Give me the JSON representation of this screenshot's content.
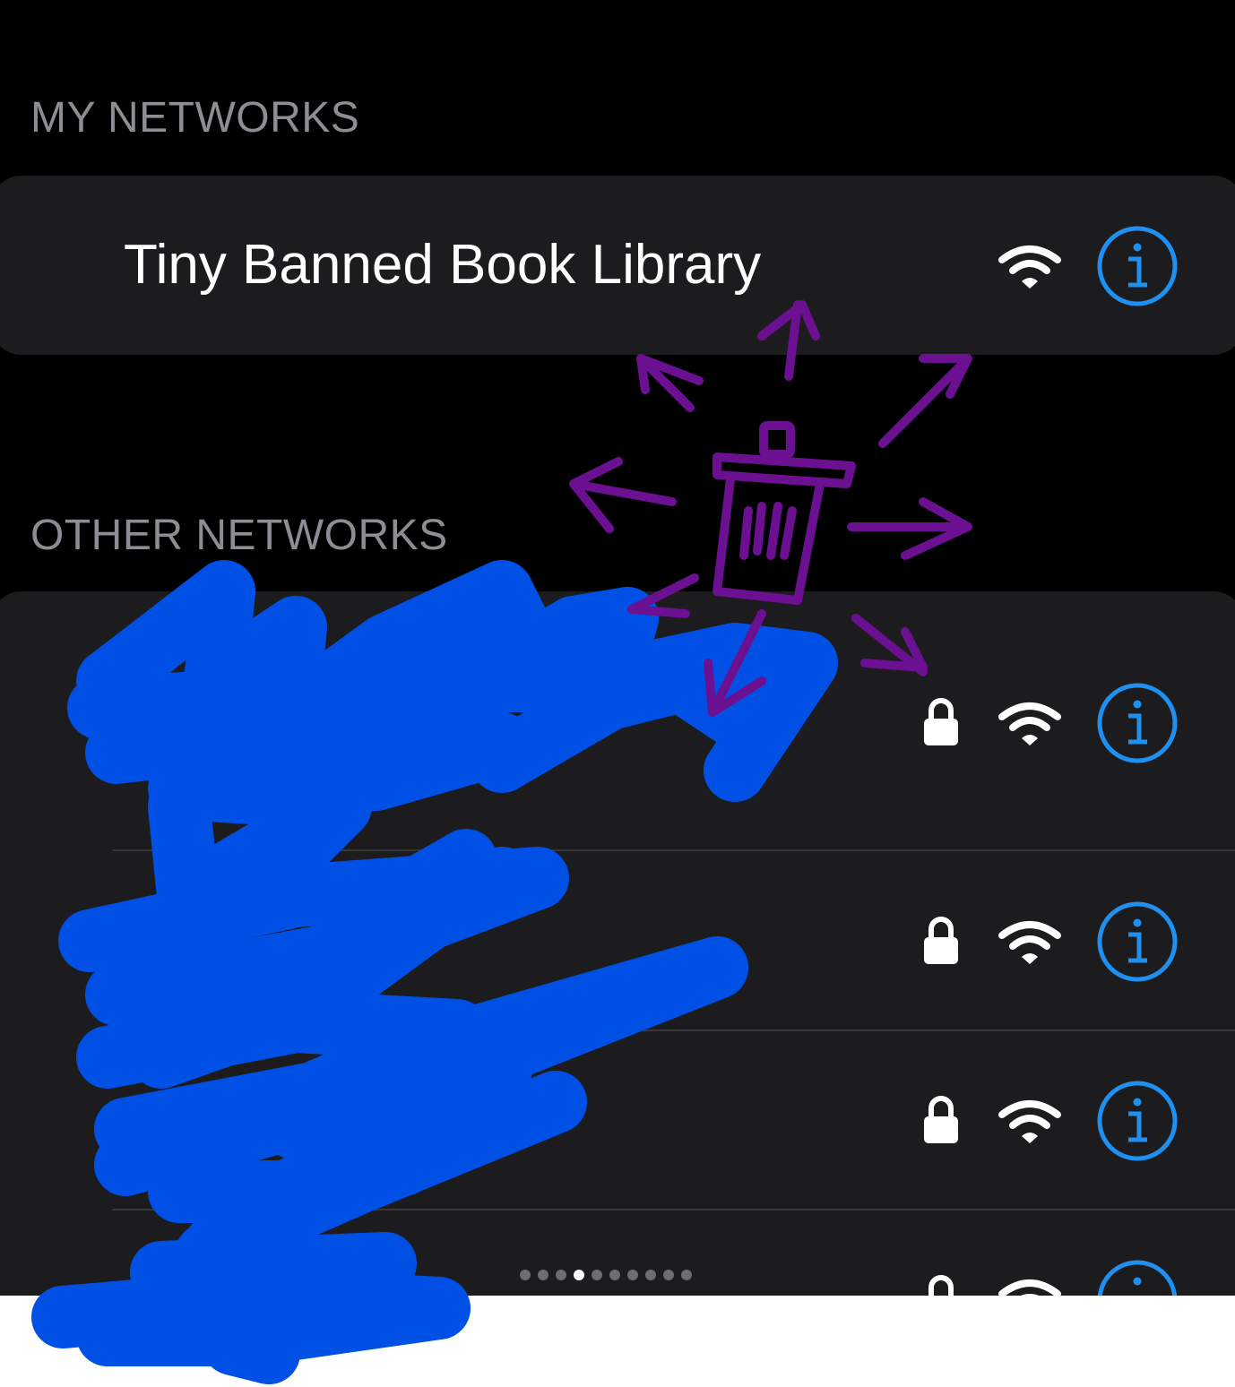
{
  "my_networks": {
    "header": "MY NETWORKS",
    "networks": [
      {
        "name": "Tiny Banned Book Library",
        "secured": false
      }
    ]
  },
  "other_networks": {
    "header": "OTHER NETWORKS",
    "networks": [
      {
        "name": "",
        "secured": true,
        "redacted": true
      },
      {
        "name": "",
        "secured": true,
        "redacted": true
      },
      {
        "name": "",
        "secured": true,
        "redacted": true
      },
      {
        "name": "",
        "secured": true,
        "redacted": true
      }
    ]
  },
  "page_indicator": {
    "count": 10,
    "current": 4
  },
  "colors": {
    "accent": "#1f8ff0",
    "scribble": "#0050e6",
    "drawing": "#6a1090",
    "cell_background": "#1c1c1e"
  },
  "annotation_icons": [
    "trash-can-icon",
    "radiating-arrows"
  ]
}
